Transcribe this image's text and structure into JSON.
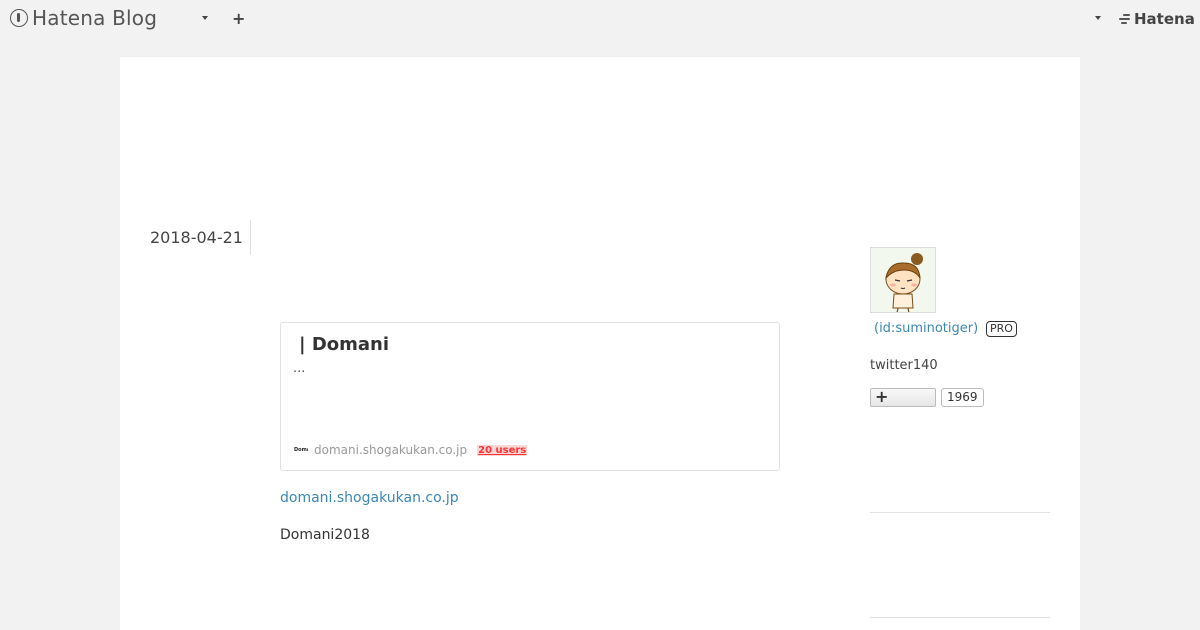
{
  "topbar": {
    "brand": "Hatena Blog",
    "add_label": "+",
    "hatena_label": "Hatena"
  },
  "entry": {
    "date": "2018-04-21",
    "card": {
      "title": "| Domani",
      "description": "...",
      "favicon_text": "Domani",
      "domain": "domani.shogakukan.co.jp",
      "users": "20 users"
    },
    "link_domain": "domani.shogakukan.co.jp",
    "body_text": "Domani2018"
  },
  "sidebar": {
    "profile_id": "(id:suminotiger)",
    "pro_label": "PRO",
    "twitter_text": "twitter140",
    "subscribe_icon": "+",
    "subscribe_count": "1969"
  },
  "icons": {
    "brand_logo": "hatena-blog-logo-icon",
    "hatena_logo": "hatena-logo-icon",
    "avatar": "cartoon-girl-avatar"
  }
}
